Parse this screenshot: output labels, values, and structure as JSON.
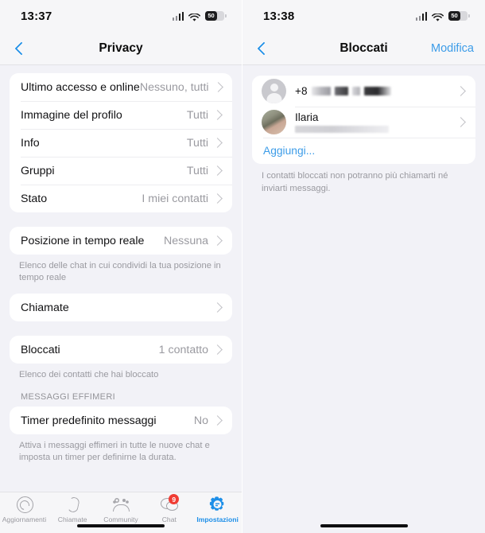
{
  "left": {
    "status": {
      "time": "13:37",
      "battery_level": "50",
      "cell_icon": "cellular-signal-icon",
      "wifi_icon": "wifi-icon",
      "battery_icon": "battery-icon"
    },
    "nav": {
      "back_icon": "back-chevron-icon",
      "title": "Privacy"
    },
    "groups": [
      {
        "rows": [
          {
            "label": "Ultimo accesso e online",
            "value": "Nessuno, tutti"
          },
          {
            "label": "Immagine del profilo",
            "value": "Tutti"
          },
          {
            "label": "Info",
            "value": "Tutti"
          },
          {
            "label": "Gruppi",
            "value": "Tutti"
          },
          {
            "label": "Stato",
            "value": "I miei contatti"
          }
        ]
      },
      {
        "rows": [
          {
            "label": "Posizione in tempo reale",
            "value": "Nessuna"
          }
        ],
        "footnote": "Elenco delle chat in cui condividi la tua posizione in tempo reale"
      },
      {
        "rows": [
          {
            "label": "Chiamate",
            "value": ""
          }
        ]
      },
      {
        "rows": [
          {
            "label": "Bloccati",
            "value": "1 contatto"
          }
        ],
        "footnote": "Elenco dei contatti che hai bloccato"
      },
      {
        "header": "MESSAGGI EFFIMERI",
        "rows": [
          {
            "label": "Timer predefinito messaggi",
            "value": "No"
          }
        ],
        "footnote": "Attiva i messaggi effimeri in tutte le nuove chat e imposta un timer per definirne la durata."
      }
    ],
    "tabs": [
      {
        "label": "Aggiornamenti",
        "icon": "updates-icon",
        "active": false,
        "badge": ""
      },
      {
        "label": "Chiamate",
        "icon": "calls-icon",
        "active": false,
        "badge": ""
      },
      {
        "label": "Community",
        "icon": "community-icon",
        "active": false,
        "badge": ""
      },
      {
        "label": "Chat",
        "icon": "chat-icon",
        "active": false,
        "badge": "9"
      },
      {
        "label": "Impostazioni",
        "icon": "settings-gear-icon",
        "active": true,
        "badge": ""
      }
    ]
  },
  "right": {
    "status": {
      "time": "13:38",
      "battery_level": "50",
      "cell_icon": "cellular-signal-icon",
      "wifi_icon": "wifi-icon",
      "battery_icon": "battery-icon"
    },
    "nav": {
      "back_icon": "back-chevron-icon",
      "title": "Bloccati",
      "action": "Modifica"
    },
    "blocked": [
      {
        "name_prefix": "+8",
        "name": "",
        "avatar": "default",
        "redacted": true
      },
      {
        "name_prefix": "",
        "name": "Ilaria",
        "avatar": "photo",
        "redacted": true
      }
    ],
    "add_label": "Aggiungi...",
    "note": "I contatti bloccati non potranno più chiamarti né inviarti messaggi."
  },
  "colors": {
    "accent": "#1d8fe8",
    "link": "#3c9ce8",
    "badge": "#f03c34",
    "background": "#f2f2f7",
    "card": "#ffffff",
    "secondary_text": "#9a9aa0"
  }
}
